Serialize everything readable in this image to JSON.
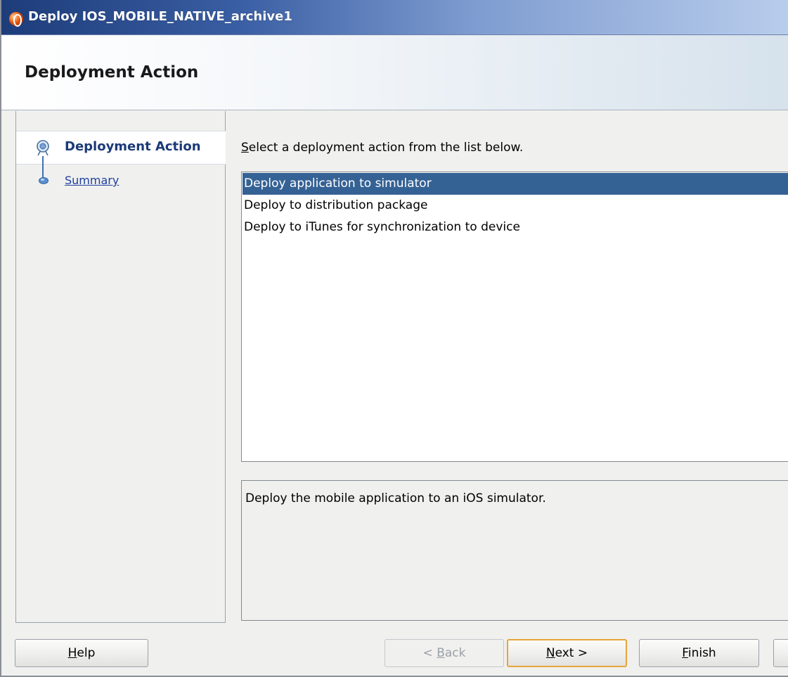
{
  "window": {
    "title": "Deploy IOS_MOBILE_NATIVE_archive1"
  },
  "header": {
    "title": "Deployment Action"
  },
  "nav": {
    "items": [
      {
        "label": "Deployment Action",
        "state": "current"
      },
      {
        "label": "Summary",
        "state": "link"
      }
    ]
  },
  "main": {
    "instruction": {
      "mnemonic": "S",
      "rest": "elect a deployment action from the list below."
    },
    "actions": [
      {
        "label": "Deploy application to simulator",
        "selected": true
      },
      {
        "label": "Deploy to distribution package",
        "selected": false
      },
      {
        "label": "Deploy to iTunes for synchronization to device",
        "selected": false
      }
    ],
    "description": "Deploy the mobile application to an iOS simulator."
  },
  "footer": {
    "help": {
      "mnemonic": "H",
      "rest": "elp"
    },
    "back": {
      "prefix": "< ",
      "mnemonic": "B",
      "rest": "ack",
      "enabled": false
    },
    "next": {
      "mnemonic": "N",
      "rest": "ext >",
      "default": true
    },
    "finish": {
      "mnemonic": "F",
      "rest": "inish"
    }
  },
  "colors": {
    "selection": "#356295",
    "default_button_border": "#e7a53a",
    "nav_current_text": "#1b3a78",
    "nav_link_text": "#1f3fa0"
  }
}
